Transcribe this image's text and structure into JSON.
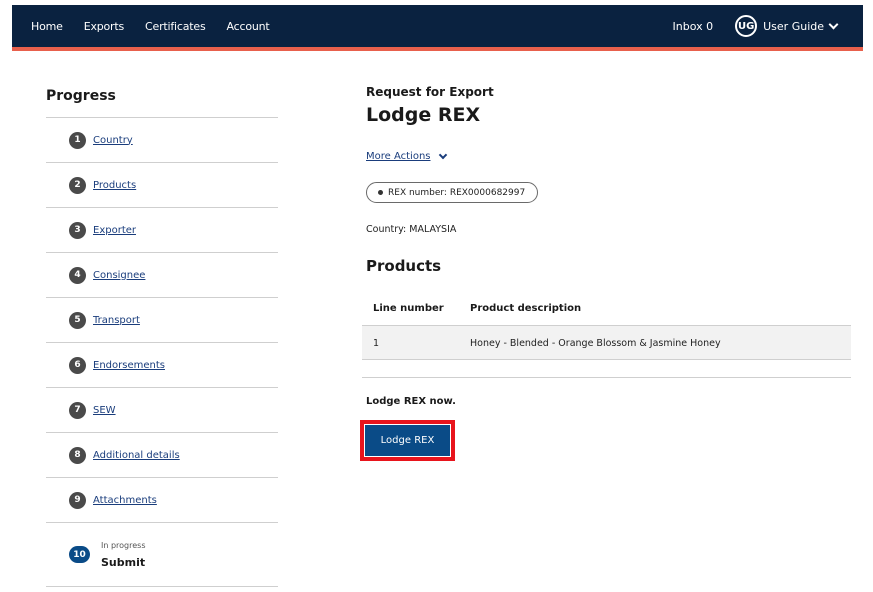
{
  "nav": {
    "items": [
      "Home",
      "Exports",
      "Certificates",
      "Account"
    ],
    "inbox": "Inbox 0",
    "avatar_initials": "UG",
    "user_name": "User Guide",
    "bar_color": "#0a2240",
    "accent_color": "#e8604c"
  },
  "progress": {
    "title": "Progress",
    "steps": [
      {
        "num": "1",
        "label": "Country"
      },
      {
        "num": "2",
        "label": "Products"
      },
      {
        "num": "3",
        "label": "Exporter"
      },
      {
        "num": "4",
        "label": "Consignee"
      },
      {
        "num": "5",
        "label": "Transport"
      },
      {
        "num": "6",
        "label": "Endorsements"
      },
      {
        "num": "7",
        "label": "SEW"
      },
      {
        "num": "8",
        "label": "Additional details"
      },
      {
        "num": "9",
        "label": "Attachments"
      }
    ],
    "current": {
      "num": "10",
      "status": "In progress",
      "label": "Submit"
    }
  },
  "main": {
    "kicker": "Request for Export",
    "title": "Lodge REX",
    "more_actions": "More Actions",
    "rex_number": "REX number: REX0000682997",
    "country": "Country:  MALAYSIA",
    "products_heading": "Products",
    "table": {
      "headers": [
        "Line number",
        "Product description"
      ],
      "rows": [
        [
          "1",
          "Honey - Blended - Orange Blossom & Jasmine Honey"
        ]
      ]
    },
    "lodge_now": "Lodge REX now.",
    "lodge_button": "Lodge REX",
    "button_color": "#0a4b87",
    "highlight_color": "#e8141c"
  }
}
